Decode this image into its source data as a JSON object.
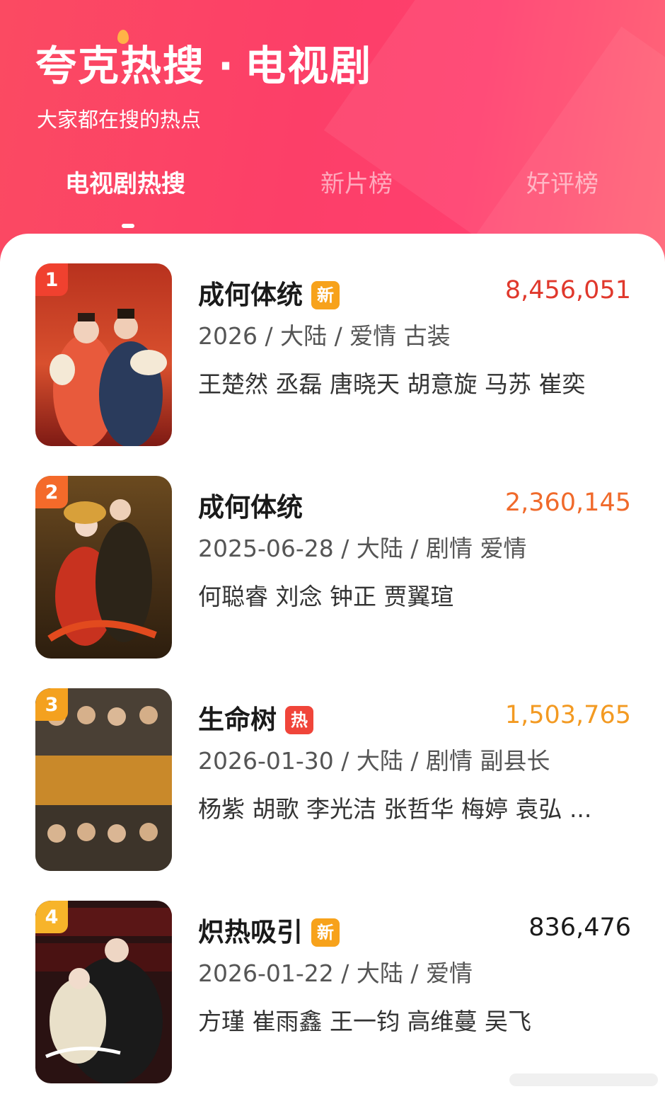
{
  "header": {
    "brand": "夸克热搜",
    "separator": "·",
    "section": "电视剧",
    "subtitle": "大家都在搜的热点"
  },
  "tabs": [
    {
      "label": "电视剧热搜",
      "active": true
    },
    {
      "label": "新片榜",
      "active": false
    },
    {
      "label": "好评榜",
      "active": false
    }
  ],
  "items": [
    {
      "rank": "1",
      "title": "成何体统",
      "badge": "新",
      "badge_color": "#f7a21b",
      "count": "8,456,051",
      "count_color": "#e0382c",
      "rank_color": "#f0412f",
      "meta": "2026 / 大陆 / 爱情 古装",
      "cast": "王楚然 丞磊 唐晓天 胡意旋 马苏 崔奕"
    },
    {
      "rank": "2",
      "title": "成何体统",
      "badge": "",
      "badge_color": "",
      "count": "2,360,145",
      "count_color": "#f06a2b",
      "rank_color": "#f46a2a",
      "meta": "2025-06-28 / 大陆 / 剧情 爱情",
      "cast": "何聪睿 刘念 钟正 贾翼瑄"
    },
    {
      "rank": "3",
      "title": "生命树",
      "badge": "热",
      "badge_color": "#f0453a",
      "count": "1,503,765",
      "count_color": "#f39a22",
      "rank_color": "#f4a11f",
      "meta": "2026-01-30 / 大陆 / 剧情 副县长",
      "cast": "杨紫 胡歌 李光洁 张哲华 梅婷 袁弘 ..."
    },
    {
      "rank": "4",
      "title": "炽热吸引",
      "badge": "新",
      "badge_color": "#f7a21b",
      "count": "836,476",
      "count_color": "#1a1a1a",
      "rank_color": "#f7b42a",
      "meta": "2026-01-22 / 大陆 / 爱情",
      "cast": "方瑾 崔雨鑫 王一钧 高维蔓 吴飞"
    }
  ]
}
